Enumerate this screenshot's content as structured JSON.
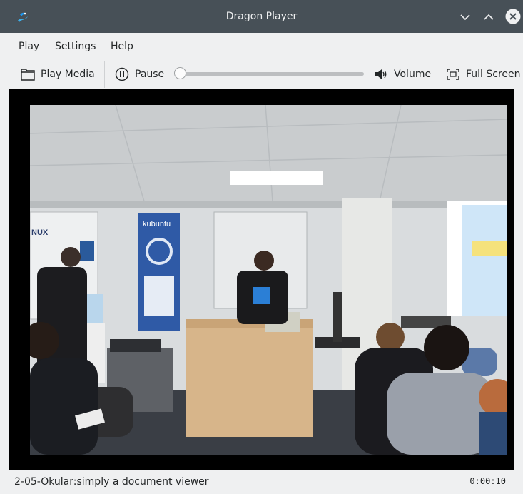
{
  "window": {
    "title": "Dragon Player"
  },
  "menu": [
    "Play",
    "Settings",
    "Help"
  ],
  "toolbar": {
    "play_media_label": "Play Media",
    "pause_label": "Pause",
    "volume_label": "Volume",
    "fullscreen_label": "Full Screen",
    "seek_position": 0.0
  },
  "video_overlay": {
    "banner_text": "kubuntu",
    "whiteboard_left_text": "NUX"
  },
  "status": {
    "track_title": "2-05-Okular:simply a document viewer",
    "time": "0:00:10"
  },
  "colors": {
    "titlebar": "#475057",
    "window_bg": "#eff0f1",
    "video_bg": "#000000",
    "close_button": "#eff0f1"
  },
  "icons": {
    "app": "dragon-player-icon",
    "minimize": "chevron-down-icon",
    "maximize": "chevron-up-icon",
    "close": "close-icon",
    "play_media": "folder-icon",
    "pause": "pause-icon",
    "volume": "speaker-icon",
    "fullscreen": "fullscreen-icon"
  }
}
